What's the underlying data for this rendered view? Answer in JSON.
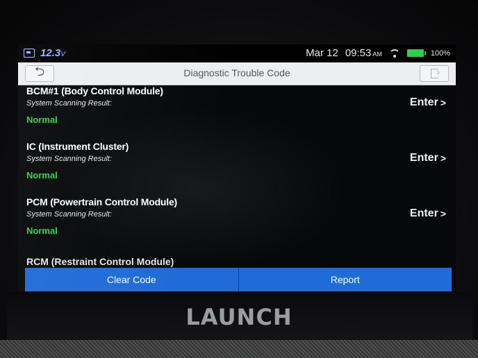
{
  "status_bar": {
    "voltage_value": "12.3",
    "voltage_unit": "V",
    "date": "Mar 12",
    "time": "09:53",
    "ampm": "AM",
    "battery_percent": "100%",
    "vci_icon": "vci-connector-icon",
    "wifi_icon": "wifi-icon",
    "battery_icon": "battery-icon"
  },
  "header": {
    "title": "Diagnostic Trouble Code",
    "back_icon": "back-arrow-icon",
    "exit_icon": "exit-icon"
  },
  "modules": [
    {
      "name": "BCM#1 (Body Control Module)",
      "scan_label": "System Scanning Result:",
      "status": "Normal",
      "action": "Enter",
      "chevron": ">"
    },
    {
      "name": "IC (Instrument Cluster)",
      "scan_label": "System Scanning Result:",
      "status": "Normal",
      "action": "Enter",
      "chevron": ">"
    },
    {
      "name": "PCM (Powertrain Control Module)",
      "scan_label": "System Scanning Result:",
      "status": "Normal",
      "action": "Enter",
      "chevron": ">"
    }
  ],
  "partial_module": "RCM (Restraint Control Module)",
  "actions": {
    "clear_code": "Clear Code",
    "report": "Report"
  },
  "colors": {
    "status_normal": "#30d24c",
    "action_blue": "#1f6bd8",
    "title_bar": "#eceef0"
  },
  "device_brand": "LAUNCH"
}
